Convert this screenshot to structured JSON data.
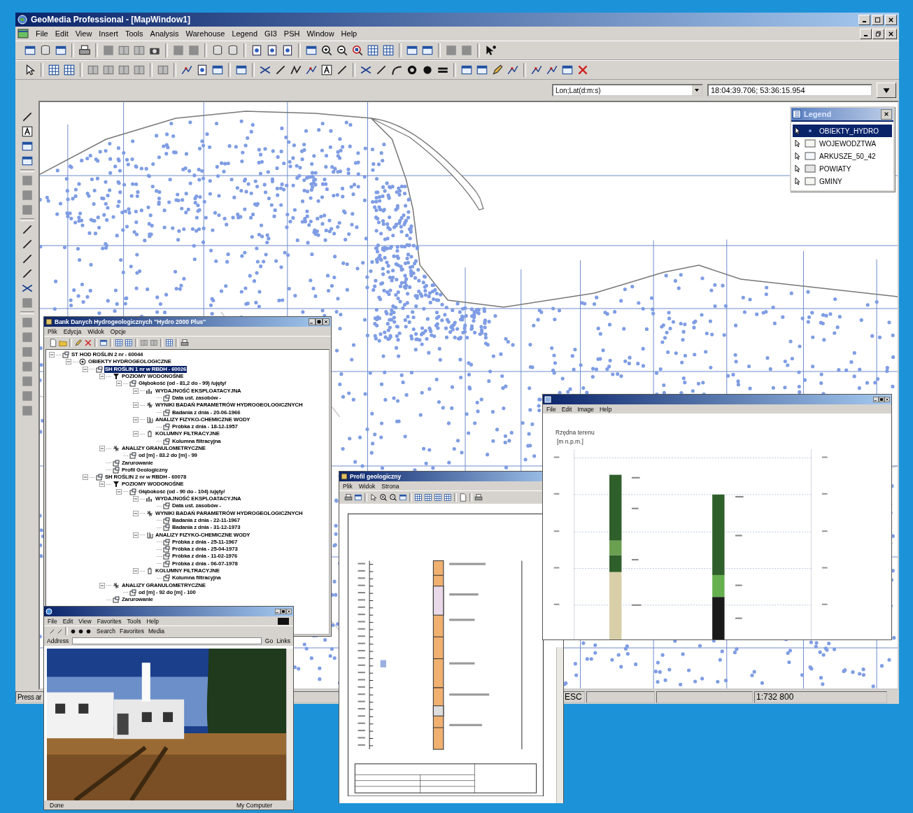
{
  "main_window": {
    "title": "GeoMedia Professional - [MapWindow1]",
    "menu": [
      "File",
      "Edit",
      "View",
      "Insert",
      "Tools",
      "Analysis",
      "Warehouse",
      "Legend",
      "GI3",
      "PSH",
      "Window",
      "Help"
    ],
    "coordinate_system": "Lon;Lat(d:m:s)",
    "coordinates": "18:04:39.706; 53:36:15.954",
    "status_bar": {
      "message": "Press ar",
      "key": "ESC",
      "scale": "1:732 800"
    }
  },
  "legend": {
    "title": "Legend",
    "items": [
      {
        "name": "OBIEKTY_HYDRO",
        "kind": "point",
        "color": "#7b9be0",
        "selected": true
      },
      {
        "name": "WOJEWODZTWA",
        "kind": "area",
        "color": "#f7f7f2",
        "selected": false
      },
      {
        "name": "ARKUSZE_50_42",
        "kind": "area",
        "color": "#f4f8ff",
        "selected": false
      },
      {
        "name": "POWIATY",
        "kind": "area",
        "color": "#e6e6e6",
        "selected": false
      },
      {
        "name": "GMINY",
        "kind": "area",
        "color": "#f7f7f2",
        "selected": false
      }
    ]
  },
  "tree_window": {
    "title": "Bank Danych Hydrogeologicznych \"Hydro 2000 Plus\"",
    "menu": [
      "Plik",
      "Edycja",
      "Widok",
      "Opcje"
    ],
    "tree": [
      {
        "label": "ST HOD ROŚLIN  2 nr - 60044",
        "kind": "record",
        "selected": false,
        "expanded": true,
        "children": [
          {
            "label": "OBIEKTY HYDROGEOLOGICZNE",
            "kind": "target",
            "selected": false,
            "expanded": true,
            "children": [
              {
                "label": "SH ROŚLIN  1 nr w RBDH - 60026",
                "kind": "record",
                "selected": true,
                "expanded": true,
                "children": [
                  {
                    "label": "POZIOMY WODONOŚNE",
                    "kind": "filter",
                    "selected": false,
                    "expanded": true,
                    "children": [
                      {
                        "label": "Głębokość (od - 81,2 do - 99) /ujęty/",
                        "kind": "record",
                        "selected": false,
                        "expanded": true,
                        "children": [
                          {
                            "label": "WYDAJNOŚĆ EKSPLOATACYJNA",
                            "kind": "yield",
                            "selected": false,
                            "expanded": true,
                            "children": [
                              {
                                "label": "Data ust. zasobów -",
                                "kind": "record",
                                "selected": false
                              }
                            ]
                          },
                          {
                            "label": "WYNIKI BADAŃ PARAMETRÓW HYDROGEOLOGICZNYCH",
                            "kind": "params",
                            "selected": false,
                            "expanded": true,
                            "children": [
                              {
                                "label": "Badania z dnia - 20-06-1966",
                                "kind": "record",
                                "selected": false
                              }
                            ]
                          },
                          {
                            "label": "ANALIZY FIZYKO-CHEMICZNE WODY",
                            "kind": "analysis",
                            "selected": false,
                            "expanded": true,
                            "children": [
                              {
                                "label": "Próbka z dnia - 18-12-1957",
                                "kind": "record",
                                "selected": false
                              }
                            ]
                          },
                          {
                            "label": "KOLUMNY FILTRACYJNE",
                            "kind": "column",
                            "selected": false,
                            "expanded": true,
                            "children": [
                              {
                                "label": "Kolumna filtracyjna",
                                "kind": "record",
                                "selected": false
                              }
                            ]
                          }
                        ]
                      }
                    ]
                  },
                  {
                    "label": "ANALIZY GRANULOMETRYCZNE",
                    "kind": "params",
                    "selected": false,
                    "expanded": true,
                    "children": [
                      {
                        "label": "od [m] - 83.2   do [m] - 99",
                        "kind": "record",
                        "selected": false
                      }
                    ]
                  },
                  {
                    "label": "Zarurowanie",
                    "kind": "record",
                    "selected": false
                  },
                  {
                    "label": "Profil Geologiczny",
                    "kind": "record",
                    "selected": false
                  }
                ]
              },
              {
                "label": "SH ROŚLIN  2 nr w RBDH - 60078",
                "kind": "record",
                "selected": false,
                "expanded": true,
                "children": [
                  {
                    "label": "POZIOMY WODONOŚNE",
                    "kind": "filter",
                    "selected": false,
                    "expanded": true,
                    "children": [
                      {
                        "label": "Głębokość (od - 90 do - 104) /ujęty/",
                        "kind": "record",
                        "selected": false,
                        "expanded": true,
                        "children": [
                          {
                            "label": "WYDAJNOŚĆ EKSPLOATACYJNA",
                            "kind": "yield",
                            "selected": false,
                            "expanded": true,
                            "children": [
                              {
                                "label": "Data ust. zasobów -",
                                "kind": "record",
                                "selected": false
                              }
                            ]
                          },
                          {
                            "label": "WYNIKI BADAŃ PARAMETRÓW HYDROGEOLOGICZNYCH",
                            "kind": "params",
                            "selected": false,
                            "expanded": true,
                            "children": [
                              {
                                "label": "Badania z dnia - 22-11-1967",
                                "kind": "record",
                                "selected": false
                              },
                              {
                                "label": "Badania z dnia - 31-12-1973",
                                "kind": "record",
                                "selected": false
                              }
                            ]
                          },
                          {
                            "label": "ANALIZY FIZYKO-CHEMICZNE WODY",
                            "kind": "analysis",
                            "selected": false,
                            "expanded": true,
                            "children": [
                              {
                                "label": "Próbka z dnia - 25-11-1967",
                                "kind": "record",
                                "selected": false
                              },
                              {
                                "label": "Próbka z dnia - 25-04-1973",
                                "kind": "record",
                                "selected": false
                              },
                              {
                                "label": "Próbka z dnia - 11-02-1976",
                                "kind": "record",
                                "selected": false
                              },
                              {
                                "label": "Próbka z dnia - 06-07-1978",
                                "kind": "record",
                                "selected": false
                              }
                            ]
                          },
                          {
                            "label": "KOLUMNY FILTRACYJNE",
                            "kind": "column",
                            "selected": false,
                            "expanded": true,
                            "children": [
                              {
                                "label": "Kolumna filtracyjna",
                                "kind": "record",
                                "selected": false
                              }
                            ]
                          }
                        ]
                      }
                    ]
                  },
                  {
                    "label": "ANALIZY GRANULOMETRYCZNE",
                    "kind": "params",
                    "selected": false,
                    "expanded": true,
                    "children": [
                      {
                        "label": "od [m] - 92   do [m] - 100",
                        "kind": "record",
                        "selected": false
                      }
                    ]
                  },
                  {
                    "label": "Zarurowanie",
                    "kind": "record",
                    "selected": false
                  }
                ]
              }
            ]
          }
        ]
      }
    ]
  },
  "browser_window": {
    "menu": [
      "File",
      "Edit",
      "View",
      "Favorites",
      "Tools",
      "Help"
    ],
    "toolbar": [
      "Search",
      "Favorites",
      "Media"
    ],
    "address_label": "Address",
    "go": "Go",
    "links": "Links",
    "status": {
      "message": "Done",
      "zone": "My Computer"
    }
  },
  "profile_window": {
    "title": "Profil geologiczny",
    "menu": [
      "Plik",
      "Widok",
      "Strona"
    ]
  },
  "image_window": {
    "menu": [
      "File",
      "Edit",
      "Image",
      "Help"
    ],
    "axis_title": "Rzędna terenu",
    "axis_unit": "[m n.p.m.]"
  }
}
